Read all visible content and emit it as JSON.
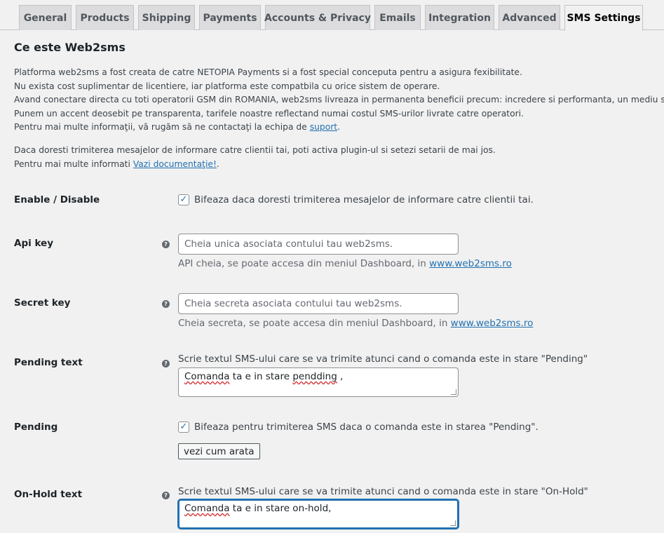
{
  "tabs": [
    {
      "label": "General"
    },
    {
      "label": "Products"
    },
    {
      "label": "Shipping"
    },
    {
      "label": "Payments"
    },
    {
      "label": "Accounts & Privacy"
    },
    {
      "label": "Emails"
    },
    {
      "label": "Integration"
    },
    {
      "label": "Advanced"
    },
    {
      "label": "SMS Settings",
      "active": true
    }
  ],
  "section": {
    "title": "Ce este Web2sms",
    "intro_lines": [
      "Platforma web2sms a fost creata de catre NETOPIA Payments si a fost special conceputa pentru a asigura fexibilitate.",
      "Nu exista cost suplimentar de licentiere, iar platforma este compatbila cu orice sistem de operare.",
      "Avand conectare directa cu toti operatorii GSM din ROMANIA, web2sms livreaza in permanenta beneficii precum: incredere si performanta, un mediu sigur de",
      "Punem un accent deosebit pe transparenta, tarifele noastre reflectand numai costul SMS-urilor livrate catre operatori."
    ],
    "contact_prefix": "Pentru mai multe informaţii, vă rugăm să ne contactaţi la echipa de ",
    "contact_link": "suport",
    "contact_suffix": ".",
    "activate_line": "Daca doresti trimiterea mesajelor de informare catre clientii tai, poti activa plugin-ul si setezi setarii de mai jos.",
    "docs_prefix": "Pentru mai multe informati ",
    "docs_link": "Vazi documentaţie!",
    "docs_suffix": "."
  },
  "fields": {
    "enable": {
      "label": "Enable / Disable",
      "checked": true,
      "checkbox_label": "Bifeaza daca doresti trimiterea mesajelor de informare catre clientii tai."
    },
    "api_key": {
      "label": "Api key",
      "placeholder": "Cheia unica asociata contului tau web2sms.",
      "desc_prefix": "API cheia, se poate accesa din meniul Dashboard, in ",
      "desc_link": "www.web2sms.ro"
    },
    "secret_key": {
      "label": "Secret key",
      "placeholder": "Cheia secreta asociata contului tau web2sms.",
      "desc_prefix": "Cheia secreta, se poate accesa din meniul Dashboard, in ",
      "desc_link": "www.web2sms.ro"
    },
    "pending_text": {
      "label": "Pending text",
      "title": "Scrie textul SMS-ului care se va trimite atunci cand o comanda este in stare \"Pending\"",
      "value_word1": "Comanda",
      "value_mid": " ta e in stare ",
      "value_word2": "pendding",
      "value_end": " ,"
    },
    "pending": {
      "label": "Pending",
      "checked": true,
      "checkbox_label": "Bifeaza pentru trimiterea SMS daca o comanda este in starea \"Pending\".",
      "button_label": "vezi cum arata"
    },
    "onhold_text": {
      "label": "On-Hold text",
      "title": "Scrie textul SMS-ului care se va trimite atunci cand o comanda este in stare \"On-Hold\"",
      "value_word1": "Comanda",
      "value_rest": " ta e in stare on-hold,"
    }
  },
  "icons": {
    "help": "question-circle-icon",
    "check": "checkmark-icon"
  },
  "colors": {
    "link": "#2271b1",
    "background": "#f1f1f1",
    "focus": "#2271b1"
  }
}
